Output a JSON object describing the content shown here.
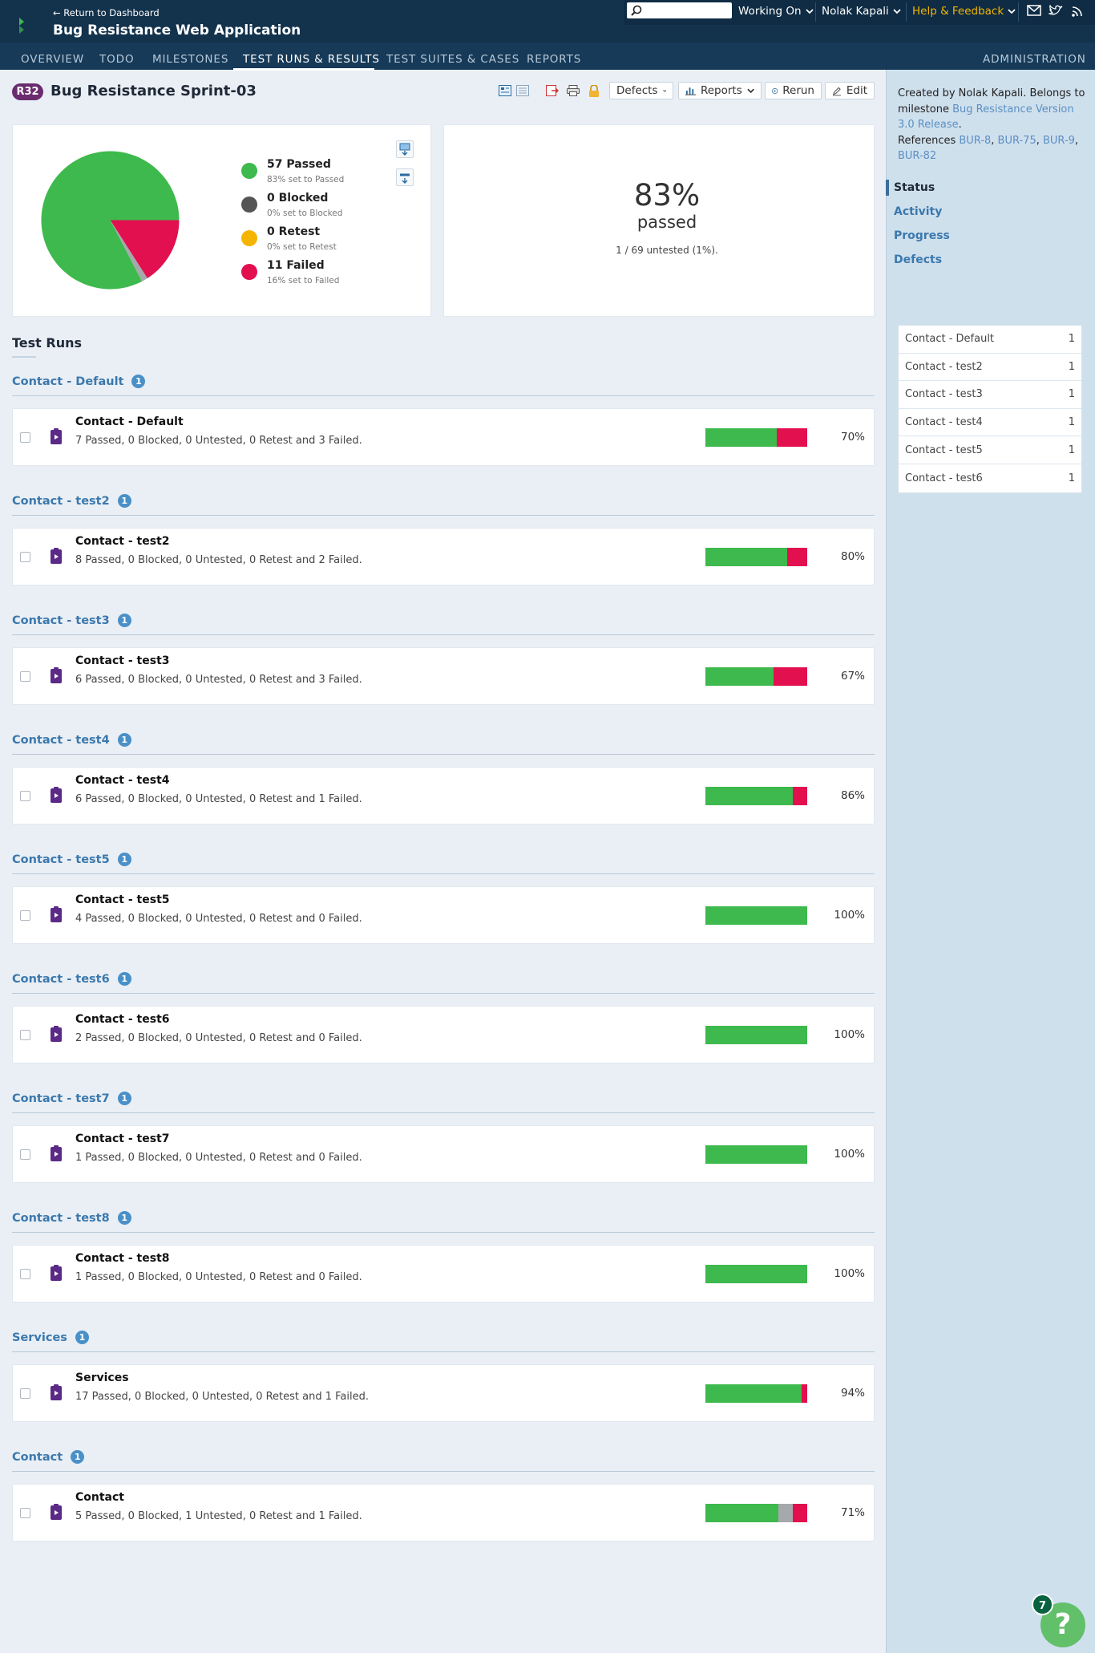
{
  "header": {
    "return_link": "← Return to Dashboard",
    "app_title": "Bug Resistance Web Application",
    "search_placeholder": "",
    "working_on": "Working On",
    "user": "Nolak Kapali",
    "help": "Help & Feedback"
  },
  "nav": {
    "items": [
      "OVERVIEW",
      "TODO",
      "MILESTONES",
      "TEST RUNS & RESULTS",
      "TEST SUITES & CASES",
      "REPORTS"
    ],
    "admin": "ADMINISTRATION"
  },
  "run": {
    "id": "R32",
    "title": "Bug Resistance Sprint-03",
    "buttons": {
      "defects": "Defects",
      "reports": "Reports",
      "rerun": "Rerun",
      "edit": "Edit"
    }
  },
  "status": {
    "legend": [
      {
        "title": "57 Passed",
        "sub": "83% set to Passed",
        "color": "#3eb94d"
      },
      {
        "title": "0 Blocked",
        "sub": "0% set to Blocked",
        "color": "#555555"
      },
      {
        "title": "0 Retest",
        "sub": "0% set to Retest",
        "color": "#f5b400"
      },
      {
        "title": "11 Failed",
        "sub": "16% set to Failed",
        "color": "#e2104f"
      }
    ],
    "percent": "83%",
    "percent_word": "passed",
    "untested": "1 / 69 untested (1%)."
  },
  "pie": {
    "passed": 57,
    "blocked": 0,
    "retest": 0,
    "failed": 11,
    "untested": 1
  },
  "test_runs": {
    "heading": "Test Runs",
    "groups": [
      {
        "name": "Contact - Default",
        "count": "1",
        "run": "Contact - Default",
        "summary": "7 Passed, 0 Blocked, 0 Untested, 0 Retest and 3 Failed.",
        "percent": "70%",
        "passed": 7,
        "untested": 0,
        "failed": 3
      },
      {
        "name": "Contact - test2",
        "count": "1",
        "run": "Contact - test2",
        "summary": "8 Passed, 0 Blocked, 0 Untested, 0 Retest and 2 Failed.",
        "percent": "80%",
        "passed": 8,
        "untested": 0,
        "failed": 2
      },
      {
        "name": "Contact - test3",
        "count": "1",
        "run": "Contact - test3",
        "summary": "6 Passed, 0 Blocked, 0 Untested, 0 Retest and 3 Failed.",
        "percent": "67%",
        "passed": 6,
        "untested": 0,
        "failed": 3
      },
      {
        "name": "Contact - test4",
        "count": "1",
        "run": "Contact - test4",
        "summary": "6 Passed, 0 Blocked, 0 Untested, 0 Retest and 1 Failed.",
        "percent": "86%",
        "passed": 6,
        "untested": 0,
        "failed": 1
      },
      {
        "name": "Contact - test5",
        "count": "1",
        "run": "Contact - test5",
        "summary": "4 Passed, 0 Blocked, 0 Untested, 0 Retest and 0 Failed.",
        "percent": "100%",
        "passed": 4,
        "untested": 0,
        "failed": 0
      },
      {
        "name": "Contact - test6",
        "count": "1",
        "run": "Contact - test6",
        "summary": "2 Passed, 0 Blocked, 0 Untested, 0 Retest and 0 Failed.",
        "percent": "100%",
        "passed": 2,
        "untested": 0,
        "failed": 0
      },
      {
        "name": "Contact - test7",
        "count": "1",
        "run": "Contact - test7",
        "summary": "1 Passed, 0 Blocked, 0 Untested, 0 Retest and 0 Failed.",
        "percent": "100%",
        "passed": 1,
        "untested": 0,
        "failed": 0
      },
      {
        "name": "Contact - test8",
        "count": "1",
        "run": "Contact - test8",
        "summary": "1 Passed, 0 Blocked, 0 Untested, 0 Retest and 0 Failed.",
        "percent": "100%",
        "passed": 1,
        "untested": 0,
        "failed": 0
      },
      {
        "name": "Services",
        "count": "1",
        "run": "Services",
        "summary": "17 Passed, 0 Blocked, 0 Untested, 0 Retest and 1 Failed.",
        "percent": "94%",
        "passed": 17,
        "untested": 0,
        "failed": 1
      },
      {
        "name": "Contact",
        "count": "1",
        "run": "Contact",
        "summary": "5 Passed, 0 Blocked, 1 Untested, 0 Retest and 1 Failed.",
        "percent": "71%",
        "passed": 5,
        "untested": 1,
        "failed": 1
      }
    ]
  },
  "sidebar": {
    "created_prefix": "Created by Nolak Kapali. Belongs to milestone ",
    "milestone": "Bug Resistance Version 3.0 Release",
    "references_label": "References ",
    "references": [
      "BUR-8",
      "BUR-75",
      "BUR-9",
      "BUR-82"
    ],
    "tabs": [
      "Status",
      "Activity",
      "Progress",
      "Defects"
    ],
    "runs": [
      {
        "name": "Contact - Default",
        "count": "1"
      },
      {
        "name": "Contact - test2",
        "count": "1"
      },
      {
        "name": "Contact - test3",
        "count": "1"
      },
      {
        "name": "Contact - test4",
        "count": "1"
      },
      {
        "name": "Contact - test5",
        "count": "1"
      },
      {
        "name": "Contact - test6",
        "count": "1"
      }
    ]
  },
  "help_fab": {
    "count": "7",
    "label": "?"
  },
  "colors": {
    "passed": "#3eb94d",
    "failed": "#e2104f",
    "untested": "#a6a9ab",
    "accent": "#3b78ad"
  }
}
